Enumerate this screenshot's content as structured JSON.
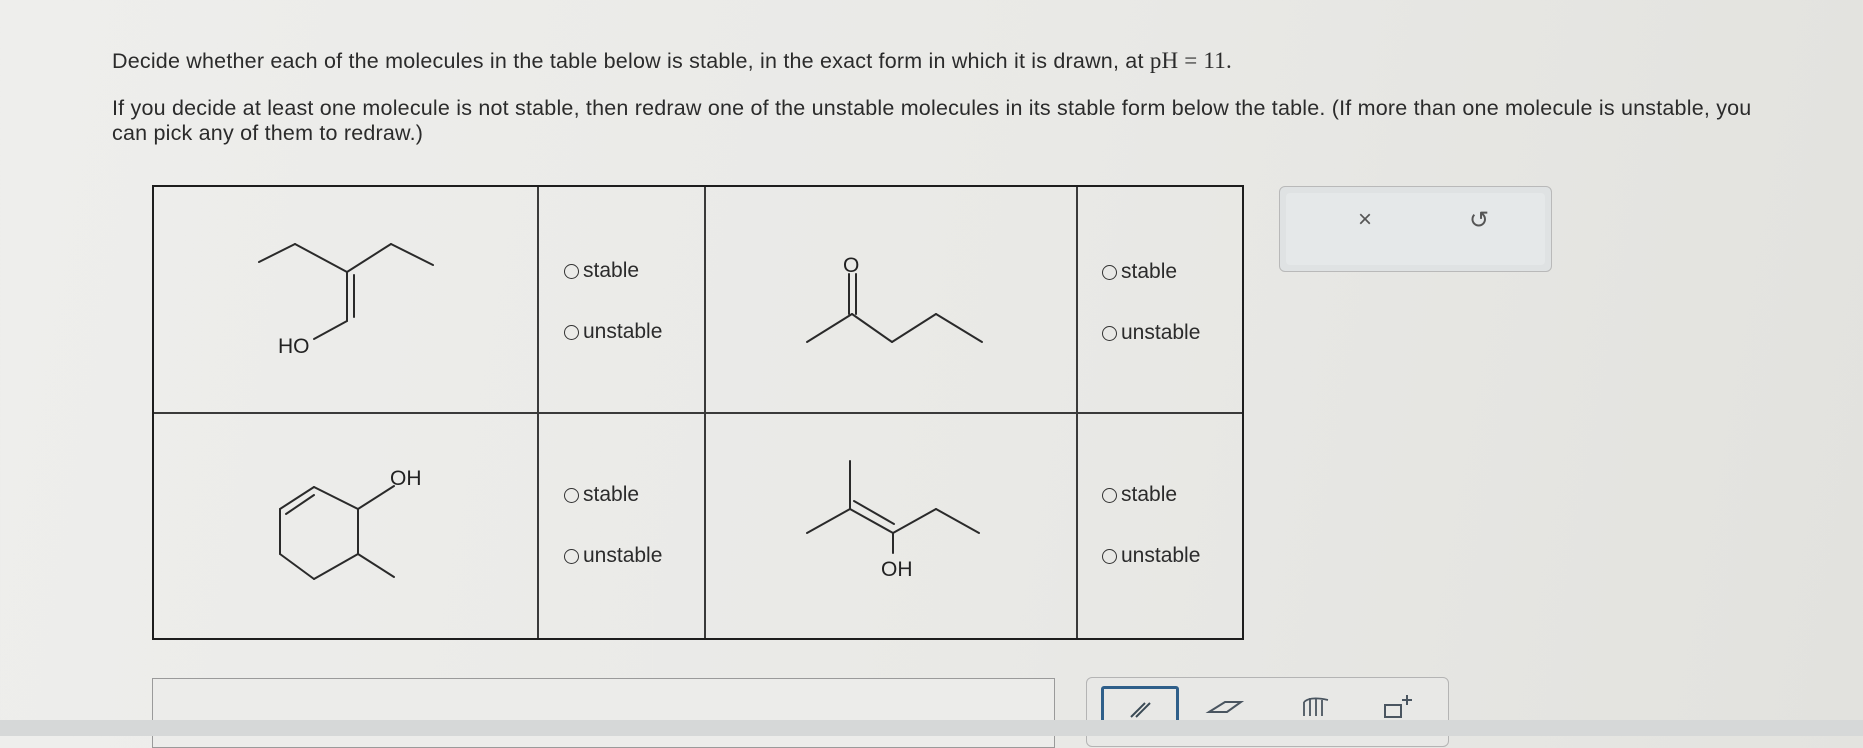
{
  "question": {
    "line1_prefix": "Decide whether each of the molecules in the table below is stable, in the exact form in which it is drawn, at",
    "ph_value": "pH = 11.",
    "line2": "If you decide at least one molecule is not stable, then redraw one of the unstable molecules in its stable form below the table. (If more than one molecule is unstable, you can pick any of them to redraw.)"
  },
  "table": {
    "cells": [
      {
        "molecule_labels": [
          "HO"
        ],
        "options": [
          "stable",
          "unstable"
        ]
      },
      {
        "molecule_labels": [
          "O"
        ],
        "options": [
          "stable",
          "unstable"
        ]
      },
      {
        "molecule_labels": [
          "OH"
        ],
        "options": [
          "stable",
          "unstable"
        ]
      },
      {
        "molecule_labels": [
          "OH"
        ],
        "options": [
          "stable",
          "unstable"
        ]
      }
    ]
  },
  "toolbar": {
    "clear_icon": "×",
    "undo_icon": "↺"
  },
  "icons": {
    "clear": "x-icon",
    "undo": "undo-icon",
    "pencil": "pencil-icon",
    "eraser": "eraser-icon",
    "hand": "hand-icon",
    "template": "add-template-icon"
  }
}
